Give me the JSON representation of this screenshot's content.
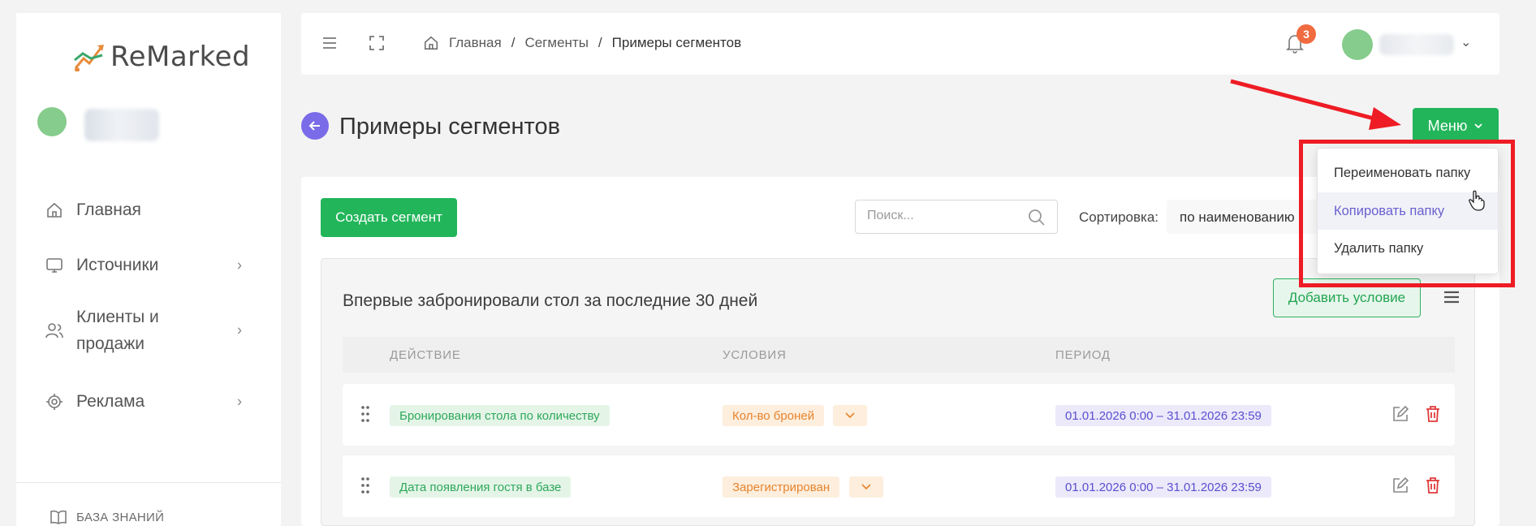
{
  "app": {
    "logo_text": "ReMarked"
  },
  "sidebar": {
    "items": [
      {
        "label": "Главная",
        "icon": "home-icon"
      },
      {
        "label": "Источники",
        "icon": "monitor-icon"
      },
      {
        "label": "Клиенты и продажи",
        "icon": "users-icon"
      },
      {
        "label": "Реклама",
        "icon": "target-icon"
      }
    ],
    "knowledge_base": "БАЗА ЗНАНИЙ"
  },
  "topbar": {
    "breadcrumbs": [
      "Главная",
      "Сегменты",
      "Примеры сегментов"
    ],
    "separator": "/",
    "notification_count": "3"
  },
  "page": {
    "title": "Примеры сегментов",
    "menu_button": "Меню"
  },
  "dropdown": {
    "items": [
      "Переименовать папку",
      "Копировать папку",
      "Удалить папку"
    ],
    "highlighted_index": 1
  },
  "toolbar": {
    "create_button": "Создать сегмент",
    "search_placeholder": "Поиск...",
    "sort_label": "Сортировка:",
    "sort_value": "по наименованию"
  },
  "segment": {
    "title": "Впервые забронировали стол за последние 30 дней",
    "add_condition_button": "Добавить условие",
    "columns": [
      "ДЕЙСТВИЕ",
      "УСЛОВИЯ",
      "ПЕРИОД"
    ],
    "rows": [
      {
        "action": "Бронирования стола по количеству",
        "condition": "Кол-во броней",
        "period": "01.01.2026 0:00 – 31.01.2026 23:59"
      },
      {
        "action": "Дата появления гостя в базе",
        "condition": "Зарегистрирован",
        "period": "01.01.2026 0:00 – 31.01.2026 23:59"
      }
    ]
  },
  "colors": {
    "accent_green": "#22b55a",
    "back_button": "#7a6be8",
    "badge": "#f06b40",
    "annotation_red": "#ee1c24"
  }
}
